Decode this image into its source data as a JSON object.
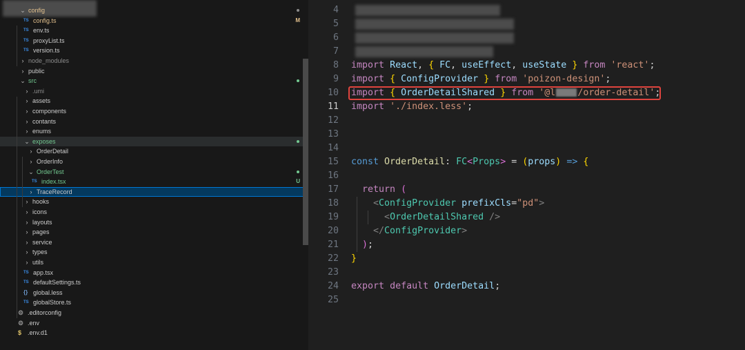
{
  "explorer": {
    "items": [
      {
        "label": "config",
        "kind": "folder",
        "open": true,
        "depth": 1,
        "status": "dot",
        "status_color": "#8c8c8c",
        "label_color": "#e2c08d"
      },
      {
        "label": "config.ts",
        "kind": "ts",
        "depth": 1,
        "status": "M",
        "status_color": "#e2c08d",
        "label_color": "#e2c08d"
      },
      {
        "label": "env.ts",
        "kind": "ts",
        "depth": 1
      },
      {
        "label": "proxyList.ts",
        "kind": "ts",
        "depth": 1
      },
      {
        "label": "version.ts",
        "kind": "ts",
        "depth": 1
      },
      {
        "label": "node_modules",
        "kind": "folder",
        "open": false,
        "depth": 1,
        "label_color": "#8c8c8c"
      },
      {
        "label": "public",
        "kind": "folder",
        "open": false,
        "depth": 1
      },
      {
        "label": "src",
        "kind": "folder",
        "open": true,
        "depth": 1,
        "status": "dot",
        "status_color": "#73c991",
        "label_color": "#73c991"
      },
      {
        "label": ".umi",
        "kind": "folder",
        "open": false,
        "depth": 2,
        "label_color": "#8c8c8c"
      },
      {
        "label": "assets",
        "kind": "folder",
        "open": false,
        "depth": 2
      },
      {
        "label": "components",
        "kind": "folder",
        "open": false,
        "depth": 2
      },
      {
        "label": "contants",
        "kind": "folder",
        "open": false,
        "depth": 2
      },
      {
        "label": "enums",
        "kind": "folder",
        "open": false,
        "depth": 2
      },
      {
        "label": "exposes",
        "kind": "folder",
        "open": true,
        "depth": 2,
        "status": "dot",
        "status_color": "#73c991",
        "label_color": "#73c991",
        "highlight": true
      },
      {
        "label": "OrderDetail",
        "kind": "folder",
        "open": false,
        "depth": 3
      },
      {
        "label": "OrderInfo",
        "kind": "folder",
        "open": false,
        "depth": 3
      },
      {
        "label": "OrderTest",
        "kind": "folder",
        "open": true,
        "depth": 3,
        "status": "dot",
        "status_color": "#73c991",
        "label_color": "#73c991"
      },
      {
        "label": "index.tsx",
        "kind": "ts",
        "depth": 3,
        "status": "U",
        "status_color": "#73c991",
        "label_color": "#73c991"
      },
      {
        "label": "TraceRecord",
        "kind": "folder",
        "open": false,
        "depth": 3,
        "selected": true
      },
      {
        "label": "hooks",
        "kind": "folder",
        "open": false,
        "depth": 2
      },
      {
        "label": "icons",
        "kind": "folder",
        "open": false,
        "depth": 2
      },
      {
        "label": "layouts",
        "kind": "folder",
        "open": false,
        "depth": 2
      },
      {
        "label": "pages",
        "kind": "folder",
        "open": false,
        "depth": 2
      },
      {
        "label": "service",
        "kind": "folder",
        "open": false,
        "depth": 2
      },
      {
        "label": "types",
        "kind": "folder",
        "open": false,
        "depth": 2
      },
      {
        "label": "utils",
        "kind": "folder",
        "open": false,
        "depth": 2
      },
      {
        "label": "app.tsx",
        "kind": "ts",
        "depth": 1
      },
      {
        "label": "defaultSettings.ts",
        "kind": "ts",
        "depth": 1
      },
      {
        "label": "global.less",
        "kind": "less",
        "depth": 1
      },
      {
        "label": "globalStore.ts",
        "kind": "ts",
        "depth": 1
      },
      {
        "label": ".editorconfig",
        "kind": "config",
        "depth": 0
      },
      {
        "label": ".env",
        "kind": "config",
        "depth": 0
      },
      {
        "label": ".env.d1",
        "kind": "env",
        "depth": 0
      }
    ],
    "icons": {
      "ts": "TS",
      "less": "{}",
      "config": "⚙",
      "env": "$",
      "folder_open": "⌄",
      "folder_closed": "›"
    }
  },
  "editor": {
    "active_line": 11,
    "highlighted_line": 10,
    "lines": [
      {
        "num": "4",
        "blurred": true
      },
      {
        "num": "5",
        "blurred": true
      },
      {
        "num": "6",
        "blurred": true
      },
      {
        "num": "7",
        "blurred": true
      },
      {
        "num": "8",
        "tokens": [
          {
            "t": "import",
            "c": "kw"
          },
          {
            "t": " "
          },
          {
            "t": "React",
            "c": "id"
          },
          {
            "t": ", "
          },
          {
            "t": "{",
            "c": "bk1"
          },
          {
            "t": " "
          },
          {
            "t": "FC",
            "c": "id"
          },
          {
            "t": ", "
          },
          {
            "t": "useEffect",
            "c": "id"
          },
          {
            "t": ", "
          },
          {
            "t": "useState",
            "c": "id"
          },
          {
            "t": " "
          },
          {
            "t": "}",
            "c": "bk1"
          },
          {
            "t": " "
          },
          {
            "t": "from",
            "c": "kw"
          },
          {
            "t": " "
          },
          {
            "t": "'react'",
            "c": "str"
          },
          {
            "t": ";"
          }
        ]
      },
      {
        "num": "9",
        "tokens": [
          {
            "t": "import",
            "c": "kw"
          },
          {
            "t": " "
          },
          {
            "t": "{",
            "c": "bk1"
          },
          {
            "t": " "
          },
          {
            "t": "ConfigProvider",
            "c": "id"
          },
          {
            "t": " "
          },
          {
            "t": "}",
            "c": "bk1"
          },
          {
            "t": " "
          },
          {
            "t": "from",
            "c": "kw"
          },
          {
            "t": " "
          },
          {
            "t": "'poizon-design'",
            "c": "str"
          },
          {
            "t": ";"
          }
        ]
      },
      {
        "num": "10",
        "tokens": [
          {
            "t": "import",
            "c": "kw"
          },
          {
            "t": " "
          },
          {
            "t": "{",
            "c": "bk1"
          },
          {
            "t": " "
          },
          {
            "t": "OrderDetailShared",
            "c": "id"
          },
          {
            "t": " "
          },
          {
            "t": "}",
            "c": "bk1"
          },
          {
            "t": " "
          },
          {
            "t": "from",
            "c": "kw"
          },
          {
            "t": " "
          },
          {
            "t": "'@l",
            "c": "str"
          },
          {
            "redact": true
          },
          {
            "t": "/order-detail'",
            "c": "str"
          },
          {
            "t": ";"
          }
        ]
      },
      {
        "num": "11",
        "tokens": [
          {
            "t": "import",
            "c": "kw"
          },
          {
            "t": " "
          },
          {
            "t": "'./index.less'",
            "c": "str"
          },
          {
            "t": ";"
          }
        ]
      },
      {
        "num": "12",
        "tokens": []
      },
      {
        "num": "13",
        "tokens": []
      },
      {
        "num": "14",
        "tokens": []
      },
      {
        "num": "15",
        "tokens": [
          {
            "t": "const",
            "c": "decl"
          },
          {
            "t": " "
          },
          {
            "t": "OrderDetail",
            "c": "fn"
          },
          {
            "t": ": "
          },
          {
            "t": "FC",
            "c": "ty"
          },
          {
            "t": "<",
            "c": "bk2"
          },
          {
            "t": "Props",
            "c": "ty"
          },
          {
            "t": ">",
            "c": "bk2"
          },
          {
            "t": " = "
          },
          {
            "t": "(",
            "c": "bk1"
          },
          {
            "t": "props",
            "c": "id"
          },
          {
            "t": ")",
            "c": "bk1"
          },
          {
            "t": " "
          },
          {
            "t": "=>",
            "c": "decl"
          },
          {
            "t": " "
          },
          {
            "t": "{",
            "c": "bk1"
          }
        ]
      },
      {
        "num": "16",
        "tokens": []
      },
      {
        "num": "17",
        "tokens": [
          {
            "t": "  "
          },
          {
            "t": "return",
            "c": "kw"
          },
          {
            "t": " "
          },
          {
            "t": "(",
            "c": "bk2"
          }
        ]
      },
      {
        "num": "18",
        "tokens": [
          {
            "t": "    "
          },
          {
            "t": "<",
            "c": "pun"
          },
          {
            "t": "ConfigProvider",
            "c": "tag"
          },
          {
            "t": " "
          },
          {
            "t": "prefixCls",
            "c": "attr"
          },
          {
            "t": "="
          },
          {
            "t": "\"pd\"",
            "c": "str"
          },
          {
            "t": ">",
            "c": "pun"
          }
        ]
      },
      {
        "num": "19",
        "tokens": [
          {
            "t": "      "
          },
          {
            "t": "<",
            "c": "pun"
          },
          {
            "t": "OrderDetailShared",
            "c": "tag"
          },
          {
            "t": " "
          },
          {
            "t": "/>",
            "c": "pun"
          }
        ]
      },
      {
        "num": "20",
        "tokens": [
          {
            "t": "    "
          },
          {
            "t": "</",
            "c": "pun"
          },
          {
            "t": "ConfigProvider",
            "c": "tag"
          },
          {
            "t": ">",
            "c": "pun"
          }
        ]
      },
      {
        "num": "21",
        "tokens": [
          {
            "t": "  "
          },
          {
            "t": ")",
            "c": "bk2"
          },
          {
            "t": ";"
          }
        ]
      },
      {
        "num": "22",
        "tokens": [
          {
            "t": "}",
            "c": "bk1"
          }
        ]
      },
      {
        "num": "23",
        "tokens": []
      },
      {
        "num": "24",
        "tokens": [
          {
            "t": "export",
            "c": "kw"
          },
          {
            "t": " "
          },
          {
            "t": "default",
            "c": "kw"
          },
          {
            "t": " "
          },
          {
            "t": "OrderDetail",
            "c": "id"
          },
          {
            "t": ";"
          }
        ]
      },
      {
        "num": "25",
        "tokens": []
      }
    ]
  },
  "colors": {
    "sidebar_bg": "#181818",
    "editor_bg": "#1f1f1f",
    "selection": "#04395e",
    "focus_border": "#0078d4",
    "annotation_box": "#e0443e"
  }
}
